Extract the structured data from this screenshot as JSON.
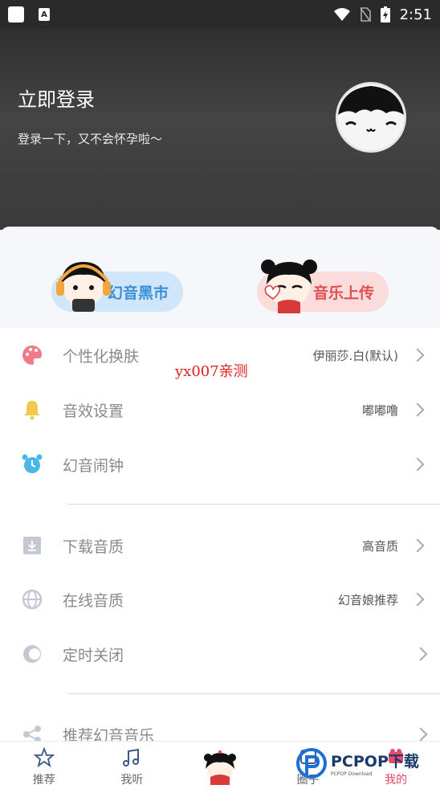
{
  "status_bar": {
    "time": "2:51",
    "icons": [
      "square-icon",
      "text-a-icon",
      "wifi-icon",
      "no-sim-icon",
      "battery-charging-icon"
    ]
  },
  "header": {
    "title": "立即登录",
    "subtitle": "登录一下，又不会怀孕啦～",
    "avatar": "avatar-face-icon"
  },
  "features": [
    {
      "label": "幻音黑市",
      "color": "#3a8fd6"
    },
    {
      "label": "音乐上传",
      "color": "#e05050"
    }
  ],
  "settings": [
    {
      "label": "个性化换肤",
      "value": "伊丽莎.白(默认)",
      "icon": "palette-icon",
      "icon_color": "#f07a8a"
    },
    {
      "label": "音效设置",
      "value": "嘟嘟噜",
      "icon": "bell-icon",
      "icon_color": "#f2c94c"
    },
    {
      "label": "幻音闹钟",
      "value": "",
      "icon": "alarm-clock-icon",
      "icon_color": "#4db6e8"
    },
    {
      "label": "下载音质",
      "value": "高音质",
      "icon": "download-icon",
      "icon_color": "#b5b9c4"
    },
    {
      "label": "在线音质",
      "value": "幻音娘推荐",
      "icon": "globe-icon",
      "icon_color": "#b5b9c4"
    },
    {
      "label": "定时关闭",
      "value": "",
      "icon": "toggle-icon",
      "icon_color": "#b5b9c4"
    },
    {
      "label": "推荐幻音音乐",
      "value": "",
      "icon": "share-icon",
      "icon_color": "#b5b9c4"
    }
  ],
  "watermark": "yx007亲测",
  "bottom_nav": [
    {
      "label": "推荐",
      "icon": "star-icon"
    },
    {
      "label": "我听",
      "icon": "music-note-icon"
    },
    {
      "label": "",
      "icon": "mascot-center-icon"
    },
    {
      "label": "圈子",
      "icon": "circle-icon"
    },
    {
      "label": "我的",
      "icon": "profile-icon",
      "active": true
    }
  ],
  "pcpop": {
    "brand": "PCPOP下载",
    "tagline": "PCPOP Download"
  }
}
